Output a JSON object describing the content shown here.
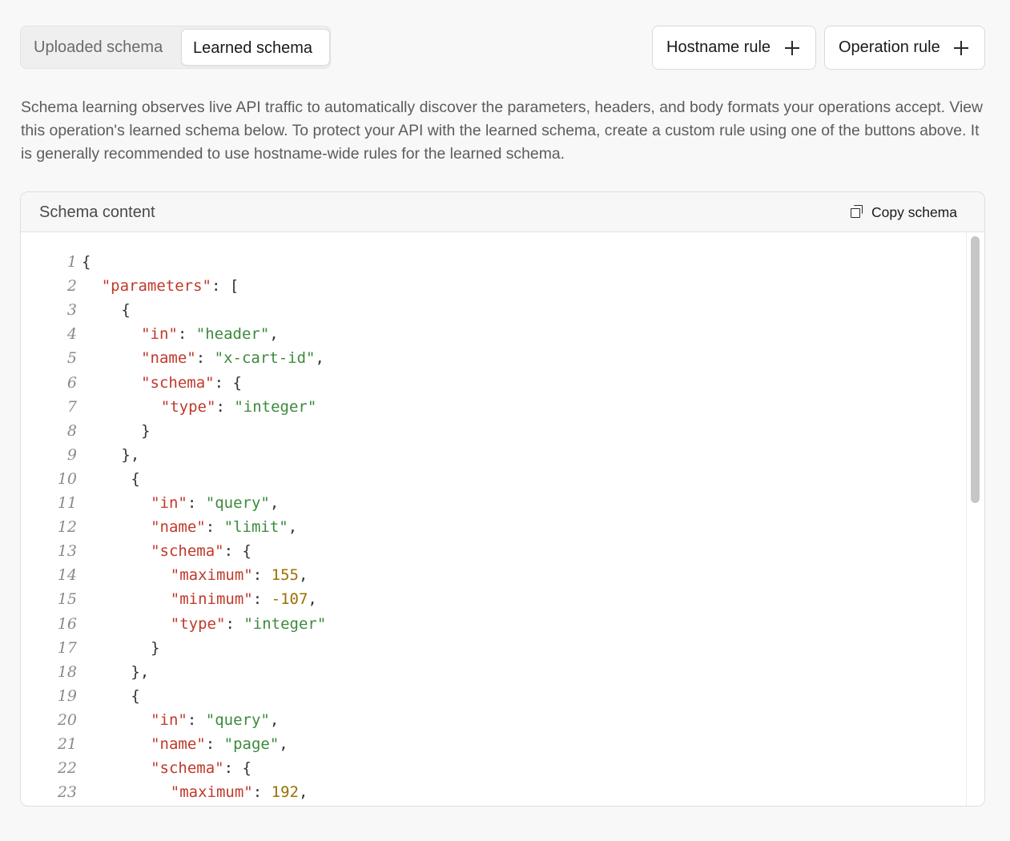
{
  "tabs": {
    "uploaded_label": "Uploaded schema",
    "learned_label": "Learned schema",
    "selected": "Learned schema"
  },
  "actions": {
    "hostname_rule_label": "Hostname rule",
    "operation_rule_label": "Operation rule"
  },
  "description": "Schema learning observes live API traffic to automatically discover the parameters, headers, and body formats your operations accept. View this operation's learned schema below. To protect your API with the learned schema, create a custom rule using one of the buttons above. It is generally recommended to use hostname-wide rules for the learned schema.",
  "panel": {
    "title": "Schema content",
    "copy_label": "Copy schema"
  },
  "code_lines": [
    {
      "n": "1",
      "indent": 0,
      "tokens": [
        [
          "p",
          "{"
        ]
      ]
    },
    {
      "n": "2",
      "indent": 1,
      "tokens": [
        [
          "k",
          "\"parameters\""
        ],
        [
          "p",
          ": ["
        ]
      ]
    },
    {
      "n": "3",
      "indent": 2,
      "tokens": [
        [
          "p",
          "{"
        ]
      ]
    },
    {
      "n": "4",
      "indent": 3,
      "tokens": [
        [
          "k",
          "\"in\""
        ],
        [
          "p",
          ": "
        ],
        [
          "s",
          "\"header\""
        ],
        [
          "p",
          ","
        ]
      ]
    },
    {
      "n": "5",
      "indent": 3,
      "tokens": [
        [
          "k",
          "\"name\""
        ],
        [
          "p",
          ": "
        ],
        [
          "s",
          "\"x-cart-id\""
        ],
        [
          "p",
          ","
        ]
      ]
    },
    {
      "n": "6",
      "indent": 3,
      "tokens": [
        [
          "k",
          "\"schema\""
        ],
        [
          "p",
          ": {"
        ]
      ]
    },
    {
      "n": "7",
      "indent": 4,
      "tokens": [
        [
          "k",
          "\"type\""
        ],
        [
          "p",
          ": "
        ],
        [
          "s",
          "\"integer\""
        ]
      ]
    },
    {
      "n": "8",
      "indent": 3,
      "tokens": [
        [
          "p",
          "}"
        ]
      ]
    },
    {
      "n": "9",
      "indent": 2,
      "tokens": [
        [
          "p",
          "},"
        ]
      ]
    },
    {
      "n": "10",
      "indent": 2,
      "tokens": [
        [
          "p",
          "{"
        ]
      ]
    },
    {
      "n": "11",
      "indent": 3,
      "tokens": [
        [
          "k",
          "\"in\""
        ],
        [
          "p",
          ": "
        ],
        [
          "s",
          "\"query\""
        ],
        [
          "p",
          ","
        ]
      ]
    },
    {
      "n": "12",
      "indent": 3,
      "tokens": [
        [
          "k",
          "\"name\""
        ],
        [
          "p",
          ": "
        ],
        [
          "s",
          "\"limit\""
        ],
        [
          "p",
          ","
        ]
      ]
    },
    {
      "n": "13",
      "indent": 3,
      "tokens": [
        [
          "k",
          "\"schema\""
        ],
        [
          "p",
          ": {"
        ]
      ]
    },
    {
      "n": "14",
      "indent": 4,
      "tokens": [
        [
          "k",
          "\"maximum\""
        ],
        [
          "p",
          ": "
        ],
        [
          "n",
          "155"
        ],
        [
          "p",
          ","
        ]
      ]
    },
    {
      "n": "15",
      "indent": 4,
      "tokens": [
        [
          "k",
          "\"minimum\""
        ],
        [
          "p",
          ": "
        ],
        [
          "n",
          "-107"
        ],
        [
          "p",
          ","
        ]
      ]
    },
    {
      "n": "16",
      "indent": 4,
      "tokens": [
        [
          "k",
          "\"type\""
        ],
        [
          "p",
          ": "
        ],
        [
          "s",
          "\"integer\""
        ]
      ]
    },
    {
      "n": "17",
      "indent": 3,
      "tokens": [
        [
          "p",
          "}"
        ]
      ]
    },
    {
      "n": "18",
      "indent": 2,
      "tokens": [
        [
          "p",
          "},"
        ]
      ]
    },
    {
      "n": "19",
      "indent": 2,
      "tokens": [
        [
          "p",
          "{"
        ]
      ]
    },
    {
      "n": "20",
      "indent": 3,
      "tokens": [
        [
          "k",
          "\"in\""
        ],
        [
          "p",
          ": "
        ],
        [
          "s",
          "\"query\""
        ],
        [
          "p",
          ","
        ]
      ]
    },
    {
      "n": "21",
      "indent": 3,
      "tokens": [
        [
          "k",
          "\"name\""
        ],
        [
          "p",
          ": "
        ],
        [
          "s",
          "\"page\""
        ],
        [
          "p",
          ","
        ]
      ]
    },
    {
      "n": "22",
      "indent": 3,
      "tokens": [
        [
          "k",
          "\"schema\""
        ],
        [
          "p",
          ": {"
        ]
      ]
    },
    {
      "n": "23",
      "indent": 4,
      "tokens": [
        [
          "k",
          "\"maximum\""
        ],
        [
          "p",
          ": "
        ],
        [
          "n",
          "192"
        ],
        [
          "p",
          ","
        ]
      ]
    }
  ],
  "colors": {
    "key": "#c0392b",
    "string": "#3c8a3c",
    "number": "#9a7000"
  }
}
